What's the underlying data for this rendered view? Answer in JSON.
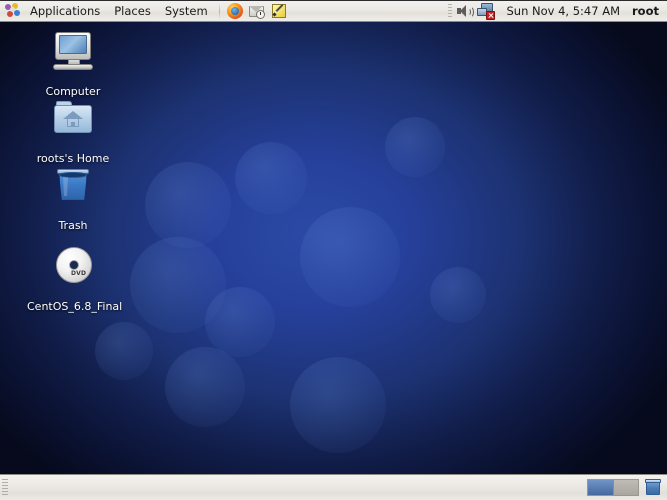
{
  "top_panel": {
    "logo_icon": "gnome-foot-logo-icon",
    "menus": [
      {
        "label": "Applications",
        "name": "menu-applications"
      },
      {
        "label": "Places",
        "name": "menu-places"
      },
      {
        "label": "System",
        "name": "menu-system"
      }
    ],
    "launchers": [
      {
        "name": "firefox-launcher-icon",
        "title": "Firefox Web Browser"
      },
      {
        "name": "evolution-mail-launcher-icon",
        "title": "Evolution Mail"
      },
      {
        "name": "notes-editor-launcher-icon",
        "title": "Text Editor"
      }
    ],
    "tray": {
      "volume_icon": "volume-speaker-icon",
      "network_icon": "network-disconnected-icon"
    },
    "clock": "Sun Nov  4,  5:47 AM",
    "user": "root"
  },
  "desktop": {
    "icons": [
      {
        "label": "Computer",
        "name": "desktop-icon-computer",
        "icon": "computer-monitor-icon"
      },
      {
        "label": "roots's Home",
        "name": "desktop-icon-home",
        "icon": "home-folder-icon"
      },
      {
        "label": "Trash",
        "name": "desktop-icon-trash",
        "icon": "trash-bin-icon"
      },
      {
        "label": "CentOS_6.8_Final",
        "name": "desktop-icon-dvd",
        "icon": "dvd-disc-icon",
        "disc_label": "DVD"
      }
    ],
    "wallpaper_colors": {
      "center": "#2b4aa6",
      "mid": "#1c3272",
      "edge": "#060a1c"
    }
  },
  "bottom_panel": {
    "window_list": [],
    "workspaces": [
      {
        "name": "workspace-1",
        "active": true
      },
      {
        "name": "workspace-2",
        "active": false
      }
    ],
    "trash_applet_icon": "trash-applet-icon"
  }
}
